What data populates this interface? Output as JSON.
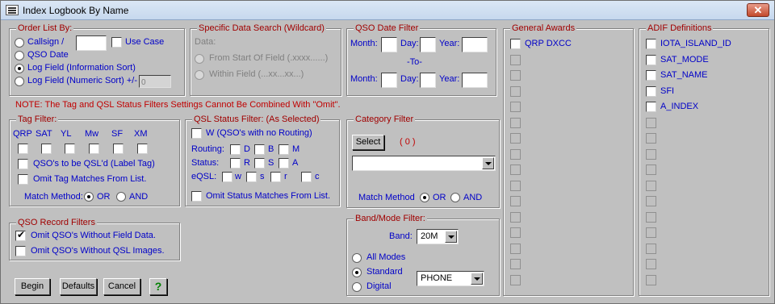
{
  "window": {
    "title": "Index Logbook By Name",
    "close": "✕"
  },
  "order": {
    "title": "Order List By:",
    "callsign": "Callsign /",
    "use_case": "Use Case",
    "qso_date": "QSO Date",
    "log_field_info": "Log Field (Information Sort)",
    "log_field_numeric": "Log Field (Numeric Sort) +/-",
    "numeric_value": "0",
    "selected": "log_field_info"
  },
  "search": {
    "title": "Specific Data Search (Wildcard)",
    "data_label": "Data:",
    "from_start": "From Start Of Field (.xxxx......)",
    "within": "Within Field (...xx...xx...)"
  },
  "date_filter": {
    "title": "QSO Date Filter",
    "month": "Month:",
    "day": "Day:",
    "year": "Year:",
    "to": "-To-"
  },
  "general_awards": {
    "title": "General Awards",
    "items": [
      "QRP DXCC"
    ]
  },
  "adif": {
    "title": "ADIF Definitions",
    "items": [
      "IOTA_ISLAND_ID",
      "SAT_MODE",
      "SAT_NAME",
      "SFI",
      "A_INDEX"
    ]
  },
  "note": "NOTE: The Tag and QSL Status Filters Settings Cannot Be Combined With \"Omit\".",
  "tag_filter": {
    "title": "Tag Filter:",
    "tags": [
      "QRP",
      "SAT",
      "YL",
      "Mw",
      "SF",
      "XM"
    ],
    "label_tag": "QSO's to be QSL'd (Label Tag)",
    "omit_tag": "Omit Tag Matches From List.",
    "match_method": "Match Method:",
    "or": "OR",
    "and": "AND"
  },
  "qsl_filter": {
    "title": "QSL Status Filter: (As Selected)",
    "w_label": "W (QSO's with no Routing)",
    "routing": "Routing:",
    "status": "Status:",
    "eqsl": "eQSL:",
    "routing_opts": [
      "D",
      "B",
      "M"
    ],
    "status_opts": [
      "R",
      "S",
      "A"
    ],
    "eqsl_opts": [
      "w",
      "s",
      "r",
      "c"
    ],
    "omit_status": "Omit Status Matches From List."
  },
  "category": {
    "title": "Category Filter",
    "select": "Select",
    "count": "( 0 )",
    "match_method": "Match Method",
    "or": "OR",
    "and": "AND"
  },
  "record_filters": {
    "title": "QSO Record Filters",
    "omit_field": "Omit QSO's Without Field Data.",
    "omit_qsl": "Omit QSO's Without QSL Images."
  },
  "band_mode": {
    "title": "Band/Mode Filter:",
    "band_label": "Band:",
    "band_value": "20M",
    "all_modes": "All Modes",
    "standard": "Standard",
    "digital": "Digital",
    "mode_value": "PHONE"
  },
  "buttons": {
    "begin": "Begin",
    "defaults": "Defaults",
    "cancel": "Cancel",
    "help": "?"
  }
}
